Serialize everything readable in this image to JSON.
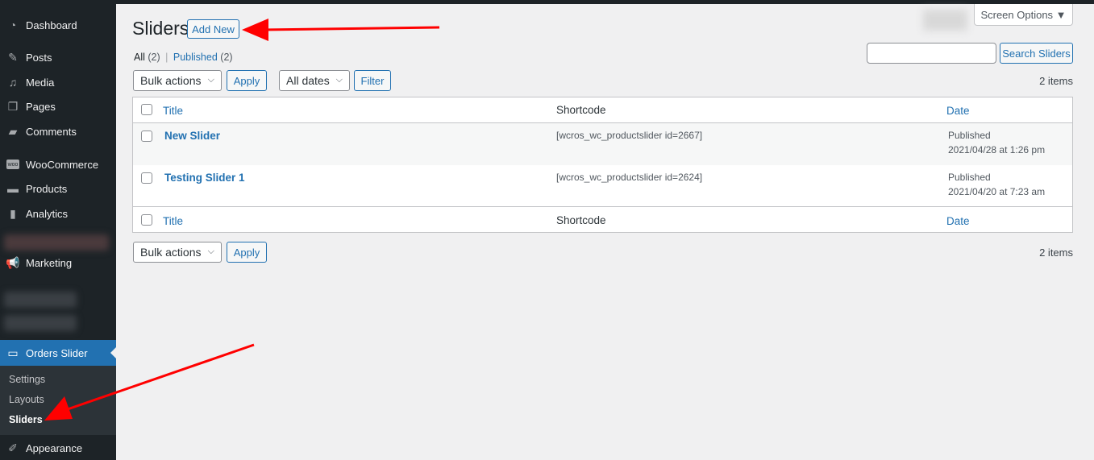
{
  "sidebar": {
    "items": [
      {
        "label": "Dashboard",
        "icon": "dashboard-icon"
      },
      {
        "label": "Posts",
        "icon": "pin-icon"
      },
      {
        "label": "Media",
        "icon": "media-icon"
      },
      {
        "label": "Pages",
        "icon": "pages-icon"
      },
      {
        "label": "Comments",
        "icon": "comment-icon"
      },
      {
        "label": "WooCommerce",
        "icon": "woo-icon"
      },
      {
        "label": "Products",
        "icon": "archive-icon"
      },
      {
        "label": "Analytics",
        "icon": "chart-bar-icon"
      },
      {
        "label": "Marketing",
        "icon": "megaphone-icon"
      },
      {
        "label": "Orders Slider",
        "icon": "slider-icon"
      },
      {
        "label": "Appearance",
        "icon": "brush-icon"
      }
    ],
    "submenu": [
      "Settings",
      "Layouts",
      "Sliders"
    ]
  },
  "header": {
    "title": "Sliders",
    "add_new": "Add New",
    "screen_options": "Screen Options ▼"
  },
  "filters": {
    "all": "All",
    "all_count": "(2)",
    "sep": "|",
    "published": "Published",
    "published_count": "(2)"
  },
  "search": {
    "value": "",
    "button": "Search Sliders"
  },
  "toolbar": {
    "bulk": "Bulk actions",
    "apply": "Apply",
    "dates": "All dates",
    "filter": "Filter",
    "items": "2 items"
  },
  "table": {
    "columns": [
      "Title",
      "Shortcode",
      "Date"
    ],
    "rows": [
      {
        "title": "New Slider",
        "shortcode": "[wcros_wc_productslider id=2667]",
        "status": "Published",
        "date": "2021/04/28 at 1:26 pm"
      },
      {
        "title": "Testing Slider 1",
        "shortcode": "[wcros_wc_productslider id=2624]",
        "status": "Published",
        "date": "2021/04/20 at 7:23 am"
      }
    ]
  },
  "colors": {
    "accent": "#2271b1",
    "sidebar": "#1d2327",
    "arrow": "#ff0000"
  }
}
